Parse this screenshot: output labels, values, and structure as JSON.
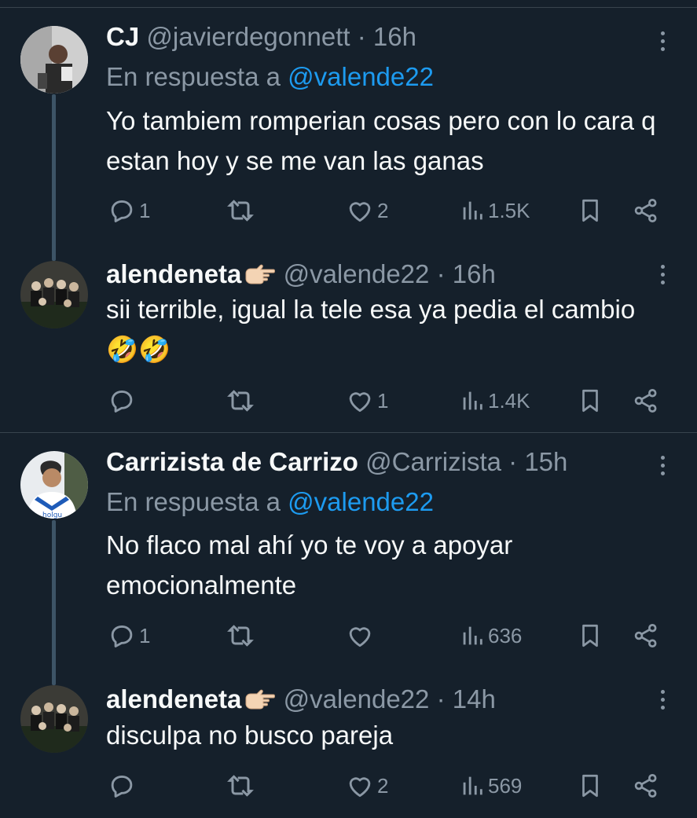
{
  "colors": {
    "background": "#15202b",
    "accent": "#1d9bf0",
    "muted": "#8b98a5",
    "text": "#f7f9f9",
    "thread_line": "#3d5466"
  },
  "tweets": [
    {
      "name": "CJ",
      "handle": "@javierdegonnett",
      "sep": "·",
      "time": "16h",
      "replying_prefix": "En respuesta a ",
      "replying_to": "@valende22",
      "text": "Yo tambiem romperian cosas pero con lo cara q estan hoy y se me van las ganas",
      "replies": "1",
      "retweets": "",
      "likes": "2",
      "views": "1.5K"
    },
    {
      "name": "alendeneta",
      "name_emoji": "👉🏻",
      "handle": "@valende22",
      "sep": "·",
      "time": "16h",
      "text": "sii terrible, igual la tele esa ya pedia el cambio 🤣🤣",
      "replies": "",
      "retweets": "",
      "likes": "1",
      "views": "1.4K"
    },
    {
      "name": "Carrizista de Carrizo",
      "handle": "@Carrizista",
      "sep": "·",
      "time": "15h",
      "replying_prefix": "En respuesta a ",
      "replying_to": "@valende22",
      "text": "No flaco mal ahí yo te voy a apoyar emocionalmente",
      "replies": "1",
      "retweets": "",
      "likes": "",
      "views": "636"
    },
    {
      "name": "alendeneta",
      "name_emoji": "👉🏻",
      "handle": "@valende22",
      "sep": "·",
      "time": "14h",
      "text": "disculpa no busco pareja",
      "replies": "",
      "retweets": "",
      "likes": "2",
      "views": "569"
    }
  ]
}
